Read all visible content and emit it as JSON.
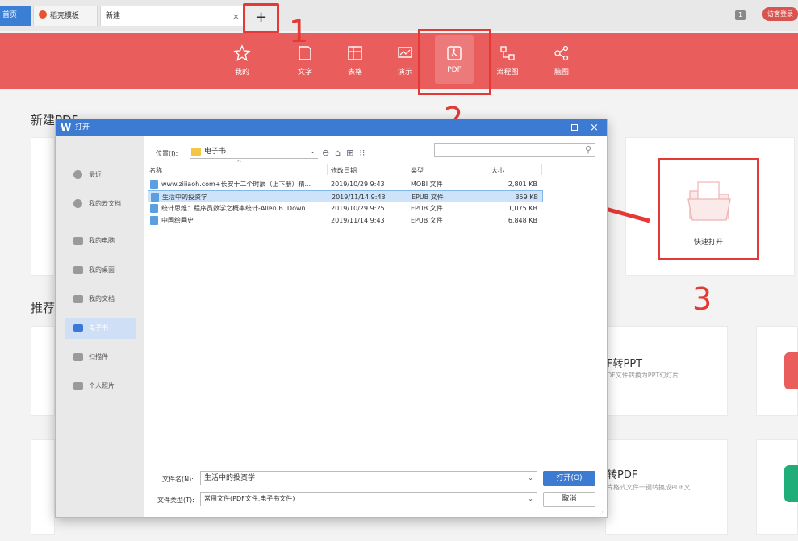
{
  "tabs": {
    "home": "首页",
    "templates": "稻壳模板",
    "new_tab": "新建",
    "close_glyph": "×",
    "add_glyph": "+"
  },
  "window": {
    "window_count": "1",
    "login": "访客登录"
  },
  "ribbon": {
    "items": [
      {
        "label": "我的",
        "icon": "star-icon"
      },
      {
        "label": "文字",
        "icon": "document-icon"
      },
      {
        "label": "表格",
        "icon": "table-icon"
      },
      {
        "label": "演示",
        "icon": "slideshow-icon"
      },
      {
        "label": "PDF",
        "icon": "pdf-icon",
        "active": true
      },
      {
        "label": "流程图",
        "icon": "flowchart-icon"
      },
      {
        "label": "脑图",
        "icon": "mindmap-icon"
      }
    ],
    "color": "#ea5d5d"
  },
  "page": {
    "title": "新建PDF",
    "quick_open": "快速打开",
    "recommend_title": "推荐",
    "card1_title": "F转PPT",
    "card1_desc": "DF文件转换为PPT幻灯片",
    "card2_title": "转PDF",
    "card2_desc": "片格式文件一键转换成PDF文"
  },
  "annotations": {
    "step1": "1",
    "step2": "2",
    "step3": "3",
    "color": "#e53935"
  },
  "dialog": {
    "title": "打开",
    "logo": "W",
    "close_glyph": "×",
    "sidebar": [
      {
        "label": "最近",
        "icon": "clock-icon"
      },
      {
        "label": "我的云文档",
        "icon": "cloud-icon"
      },
      {
        "label": "我的电脑",
        "icon": "computer-icon"
      },
      {
        "label": "我的桌面",
        "icon": "desktop-icon"
      },
      {
        "label": "我的文档",
        "icon": "folder-icon"
      },
      {
        "label": "电子书",
        "icon": "folder-icon",
        "active": true
      },
      {
        "label": "扫描件",
        "icon": "folder-icon"
      },
      {
        "label": "个人照片",
        "icon": "folder-icon"
      }
    ],
    "location_label": "位置(I):",
    "location_value": "电子书",
    "dropdown_glyph": "⌄",
    "search_glyph": "⚲",
    "columns": {
      "name": "名称",
      "date": "修改日期",
      "type": "类型",
      "size": "大小"
    },
    "files": [
      {
        "name": "www.ziiiaoh.com+长安十二个时辰（上下册）精...",
        "date": "2019/10/29 9:43",
        "type": "MOBI 文件",
        "size": "2,801 KB",
        "selected": false
      },
      {
        "name": "生活中的投资学",
        "date": "2019/11/14 9:43",
        "type": "EPUB 文件",
        "size": "359 KB",
        "selected": true
      },
      {
        "name": "统计思维：程序员数学之概率统计-Allen B. Down...",
        "date": "2019/10/29 9:25",
        "type": "EPUB 文件",
        "size": "1,075 KB",
        "selected": false
      },
      {
        "name": "中国绘画史",
        "date": "2019/11/14 9:43",
        "type": "EPUB 文件",
        "size": "6,848 KB",
        "selected": false
      }
    ],
    "filename_label": "文件名(N):",
    "filename_value": "生活中的投资学",
    "filetype_label": "文件类型(T):",
    "filetype_value": "常用文件(PDF文件,电子书文件)",
    "open_button": "打开(O)",
    "cancel_button": "取消",
    "accent": "#3d7bd3"
  }
}
